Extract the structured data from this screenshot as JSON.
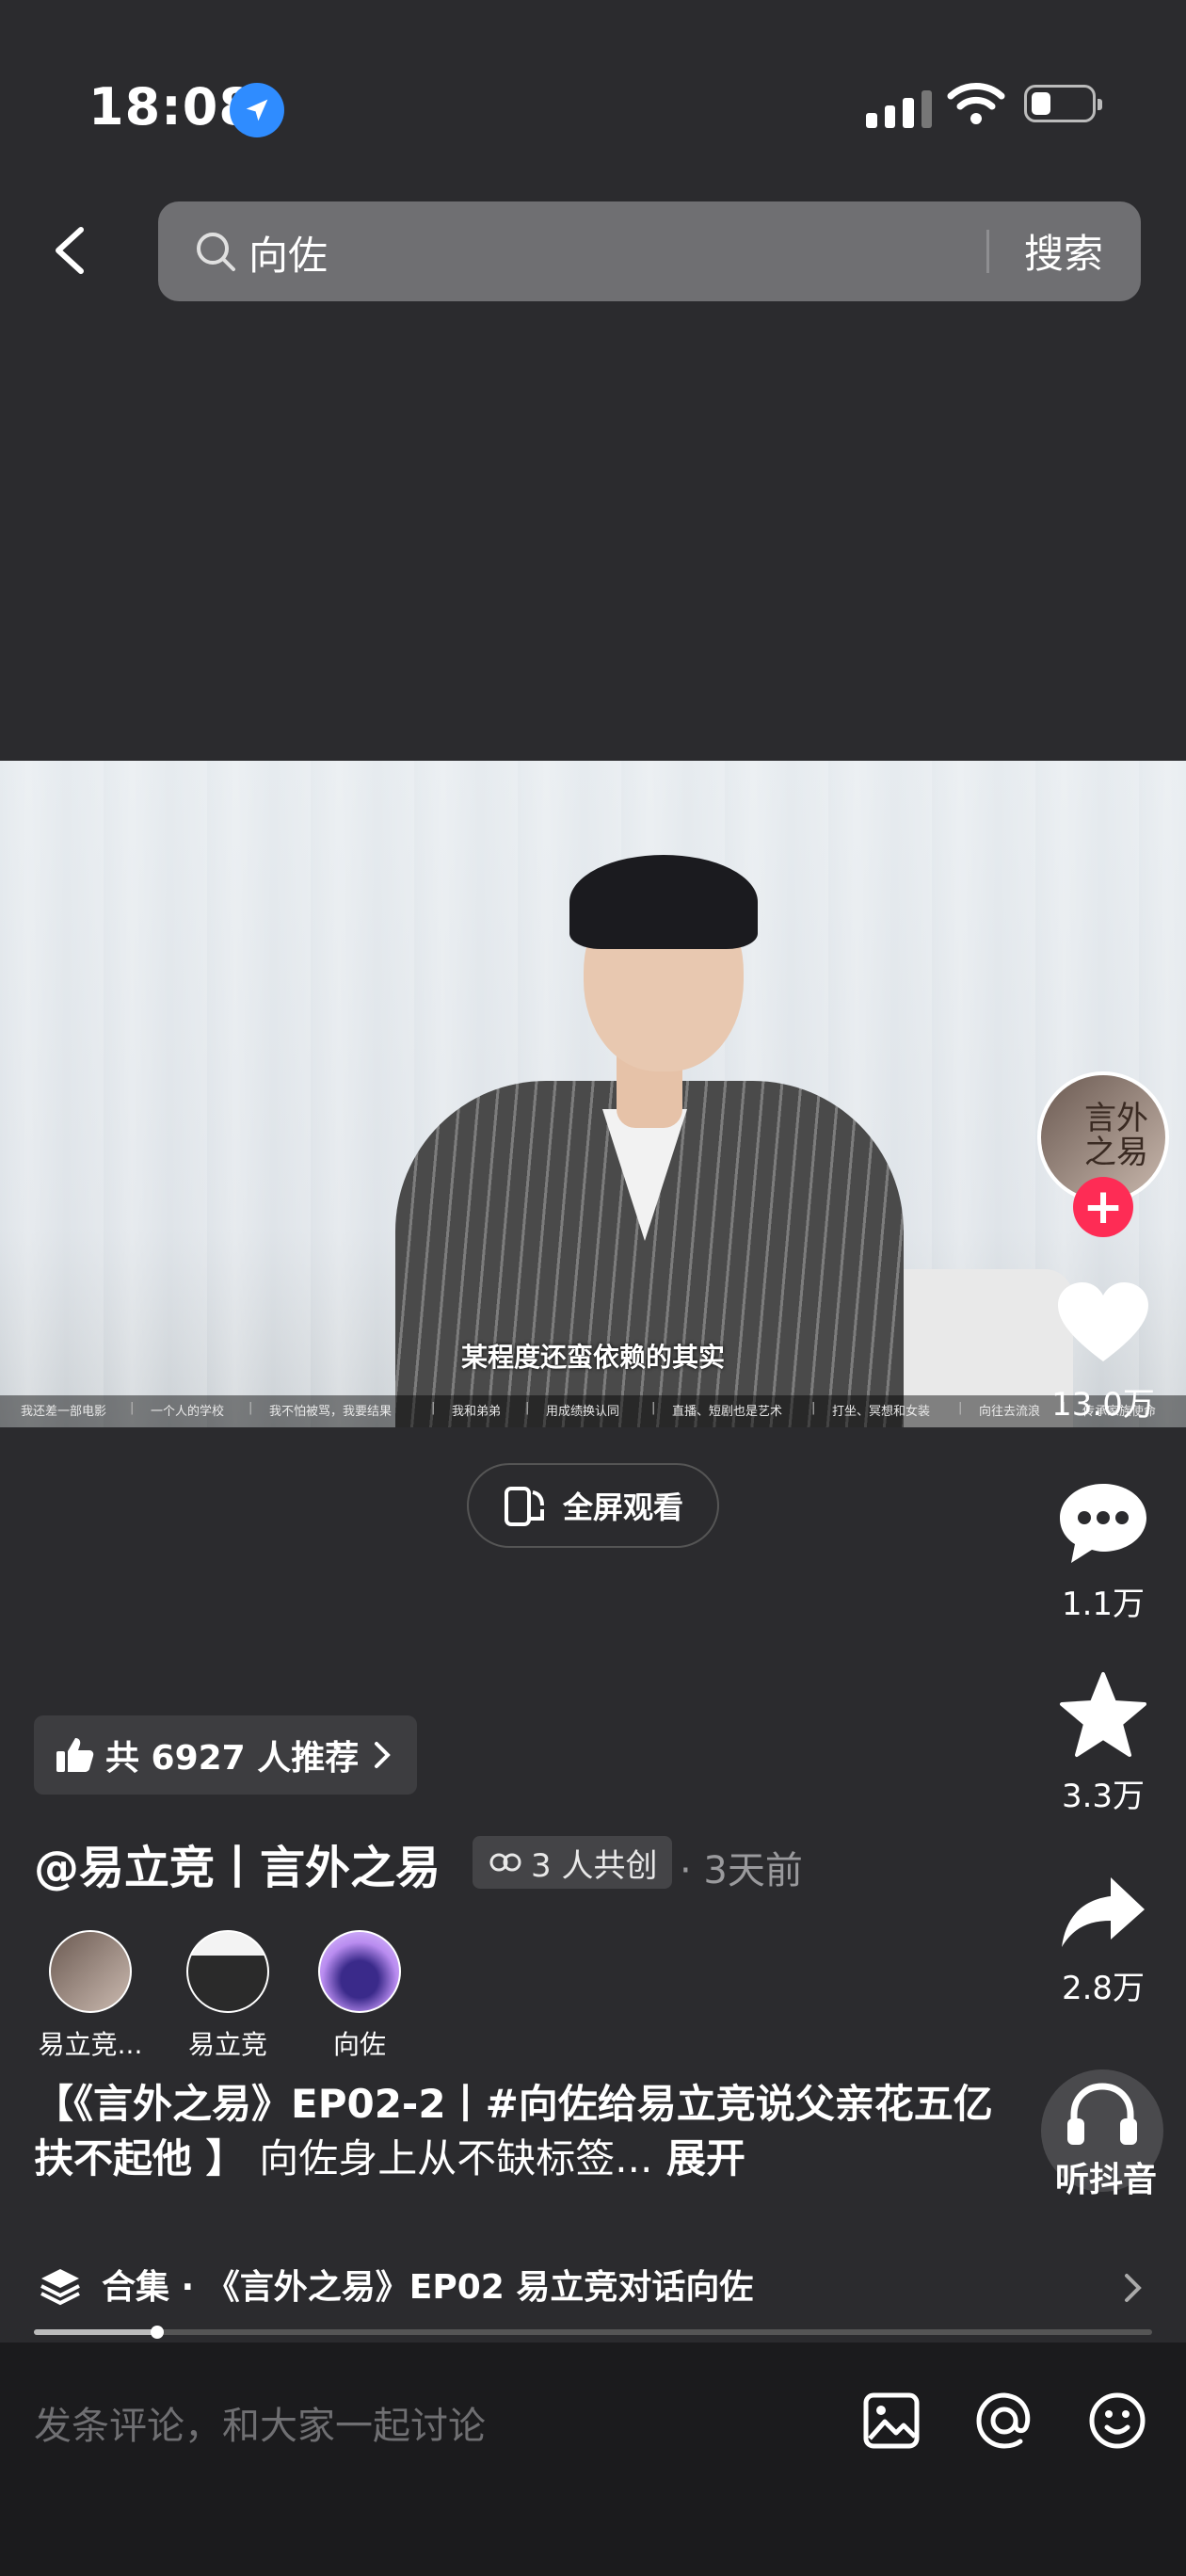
{
  "status_bar": {
    "time": "18:08"
  },
  "search": {
    "query": "向佐",
    "button": "搜索"
  },
  "video": {
    "subtitle": "某程度还蛮依赖的其实",
    "chapters": [
      "我还差一部电影",
      "一个人的学校",
      "我不怕被骂，我要结果",
      "我和弟弟",
      "用成绩换认同",
      "直播、短剧也是艺术",
      "打坐、冥想和女装",
      "向往去流浪",
      "传承家族使命"
    ]
  },
  "fullscreen_button": "全屏观看",
  "right_rail": {
    "avatar_text": "言外之易",
    "likes": "13.0万",
    "comments": "1.1万",
    "favorites": "3.3万",
    "shares": "2.8万",
    "listen_label": "听抖音"
  },
  "recommend": {
    "label": "共 6927 人推荐"
  },
  "author": {
    "name": "@易立竞丨言外之易",
    "cocreate_label": "3 人共创",
    "posted": "· 3天前"
  },
  "cocreators": [
    {
      "name": "易立竞..."
    },
    {
      "name": "易立竞"
    },
    {
      "name": "向佐"
    }
  ],
  "description": {
    "bold_text": "【《言外之易》EP02-2丨#向佐给易立竞说父亲花五亿扶不起他 】",
    "plain_text": "向佐身上从不缺标签...",
    "more": "展开"
  },
  "collection": {
    "label": "合集 · 《言外之易》EP02 易立竞对话向佐",
    "progress": 0.11
  },
  "comment_bar": {
    "placeholder": "发条评论，和大家一起讨论"
  },
  "colors": {
    "accent": "#fe2c55",
    "location": "#2f8cff",
    "background": "#2b2b2e"
  }
}
